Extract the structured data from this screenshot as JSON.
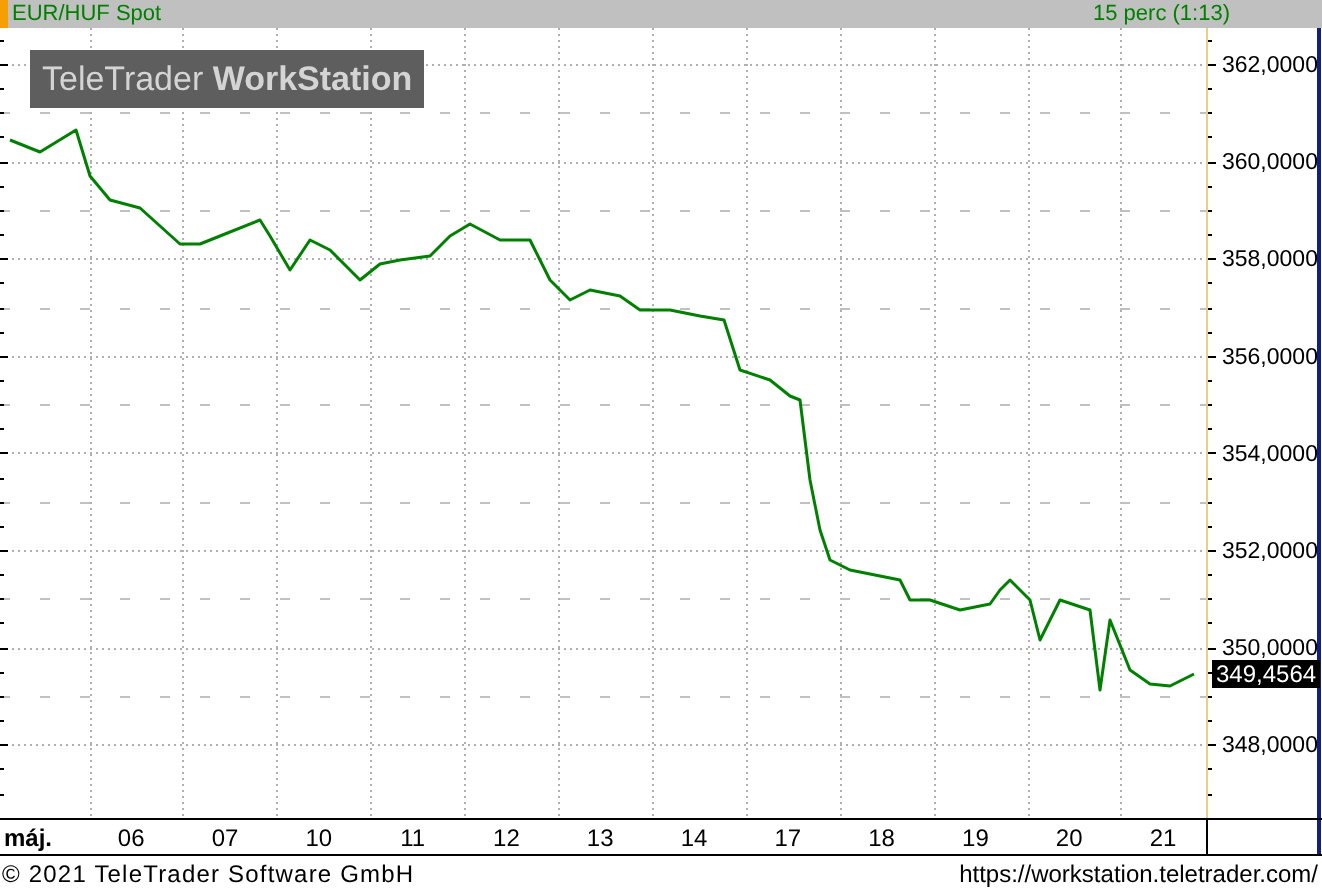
{
  "header": {
    "title": "EUR/HUF Spot",
    "interval": "15 perc (1:13)"
  },
  "logo": "TeleTrader **WorkStation**",
  "chart": {
    "price_labels": [
      "362,0000",
      "360,0000",
      "358,0000",
      "356,0000",
      "354,0000",
      "352,0000",
      "350,0000",
      "348,0000"
    ],
    "last_price": "349,4564",
    "date_labels": [
      "máj.",
      "06",
      "07",
      "10",
      "11",
      "12",
      "13",
      "14",
      "17",
      "18",
      "19",
      "20",
      "21"
    ]
  },
  "footer": {
    "copyright": "© 2021 TeleTrader Software GmbH",
    "url": "https://workstation.teletrader.com/"
  }
}
